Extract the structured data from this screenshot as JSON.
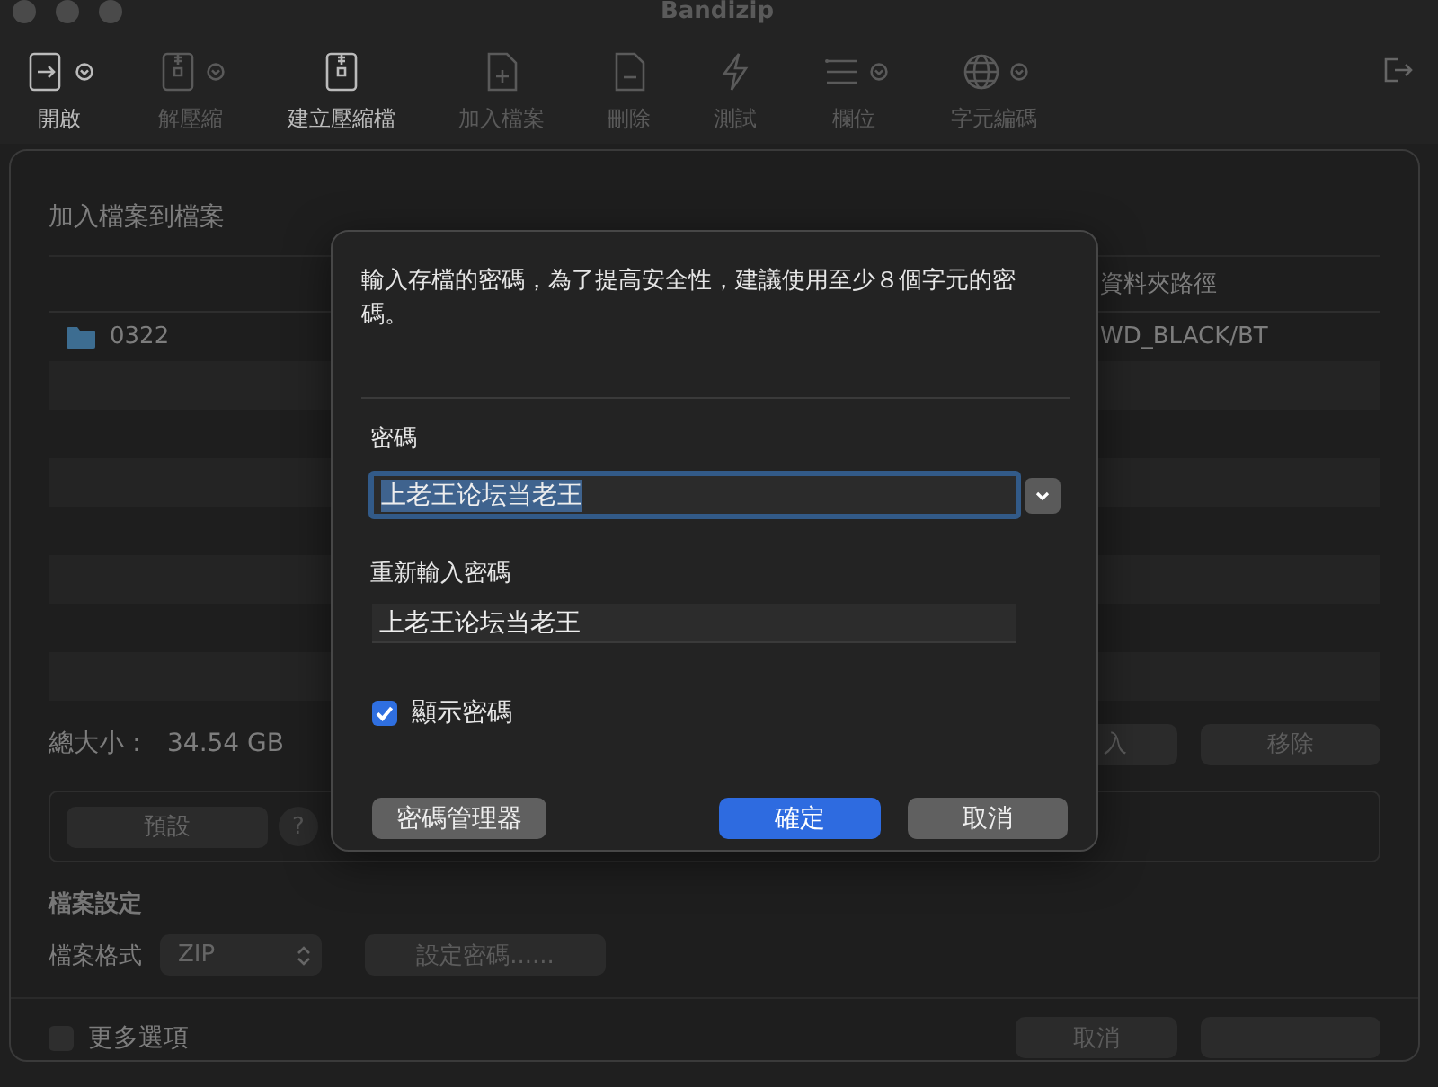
{
  "window": {
    "title": "Bandizip"
  },
  "toolbar": [
    {
      "label": "開啟",
      "kind": "open",
      "dropdown": true,
      "disabled": false
    },
    {
      "label": "解壓縮",
      "kind": "extract",
      "dropdown": true,
      "disabled": true
    },
    {
      "label": "建立壓縮檔",
      "kind": "archive",
      "dropdown": false,
      "disabled": false
    },
    {
      "label": "加入檔案",
      "kind": "add",
      "dropdown": false,
      "disabled": true
    },
    {
      "label": "刪除",
      "kind": "delete",
      "dropdown": false,
      "disabled": true
    },
    {
      "label": "測試",
      "kind": "test",
      "dropdown": false,
      "disabled": true
    },
    {
      "label": "欄位",
      "kind": "columns",
      "dropdown": true,
      "disabled": true
    },
    {
      "label": "字元編碼",
      "kind": "globe",
      "dropdown": true,
      "disabled": true
    }
  ],
  "sheet": {
    "title": "加入檔案到檔案",
    "file_list": {
      "columns": [
        "資料夾路徑"
      ],
      "rows": [
        {
          "name": "0322",
          "path": "WD_BLACK/BT"
        }
      ]
    },
    "total_size_label": "總大小：",
    "total_size": "34.54 GB",
    "list_buttons": [
      "入",
      "移除"
    ],
    "preset_button": "預設",
    "help_button": "?",
    "file_settings_title": "檔案設定",
    "format_label": "檔案格式",
    "format": "ZIP",
    "set_password_button": "設定密碼......",
    "more_options": {
      "label": "更多選項",
      "checked": false
    },
    "footer_buttons": [
      "取消"
    ]
  },
  "password_dialog": {
    "message": "輸入存檔的密碼，為了提高安全性，建議使用至少８個字元的密碼。",
    "password_label": "密碼",
    "password": {
      "value": "上老王论坛当老王",
      "text_selected": true,
      "focused": true
    },
    "confirm_label": "重新輸入密碼",
    "confirm": {
      "value": "上老王论坛当老王"
    },
    "show_password": {
      "label": "顯示密碼",
      "checked": true
    },
    "buttons": [
      {
        "label": "密碼管理器",
        "kind": "secondary"
      },
      {
        "label": "確定",
        "kind": "primary"
      },
      {
        "label": "取消",
        "kind": "secondary"
      }
    ]
  }
}
